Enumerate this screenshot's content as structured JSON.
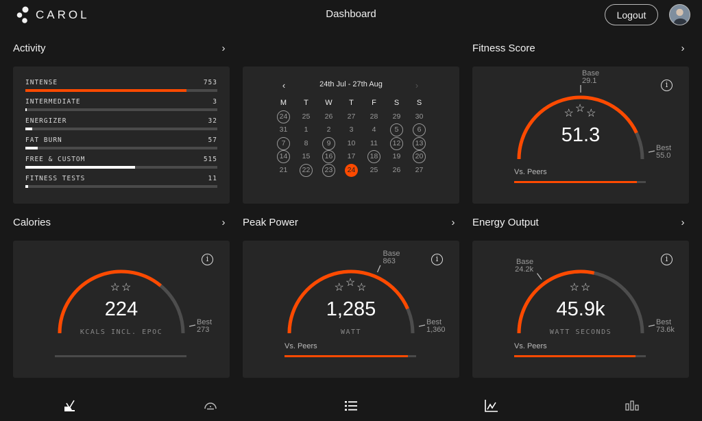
{
  "app": {
    "brand": "CAROL",
    "title": "Dashboard",
    "logout_label": "Logout",
    "accent_color": "#ff4a00"
  },
  "sections": {
    "activity": {
      "title": "Activity"
    },
    "fitness": {
      "title": "Fitness Score"
    },
    "calories": {
      "title": "Calories"
    },
    "peak": {
      "title": "Peak Power"
    },
    "energy": {
      "title": "Energy Output"
    }
  },
  "activity": {
    "items": [
      {
        "label": "INTENSE",
        "value": "753",
        "fraction": 0.84,
        "accent": true
      },
      {
        "label": "INTERMEDIATE",
        "value": "3",
        "fraction": 0.004,
        "accent": false
      },
      {
        "label": "ENERGIZER",
        "value": "32",
        "fraction": 0.036,
        "accent": false
      },
      {
        "label": "FAT BURN",
        "value": "57",
        "fraction": 0.065,
        "accent": false
      },
      {
        "label": "FREE & CUSTOM",
        "value": "515",
        "fraction": 0.571,
        "accent": false
      },
      {
        "label": "FITNESS TESTS",
        "value": "11",
        "fraction": 0.013,
        "accent": false
      }
    ]
  },
  "calendar": {
    "range": "24th Jul - 27th Aug",
    "prev_icon": "chevron-left-icon",
    "next_icon": "chevron-right-icon",
    "weekdays": [
      "M",
      "T",
      "W",
      "T",
      "F",
      "S",
      "S"
    ],
    "days": [
      {
        "d": "24",
        "ring": true
      },
      {
        "d": "25"
      },
      {
        "d": "26"
      },
      {
        "d": "27"
      },
      {
        "d": "28"
      },
      {
        "d": "29"
      },
      {
        "d": "30"
      },
      {
        "d": "31"
      },
      {
        "d": "1"
      },
      {
        "d": "2"
      },
      {
        "d": "3"
      },
      {
        "d": "4"
      },
      {
        "d": "5",
        "ring": true
      },
      {
        "d": "6",
        "ring": true
      },
      {
        "d": "7",
        "ring": true
      },
      {
        "d": "8"
      },
      {
        "d": "9",
        "ring": true
      },
      {
        "d": "10"
      },
      {
        "d": "11"
      },
      {
        "d": "12",
        "ring": true
      },
      {
        "d": "13",
        "ring": true
      },
      {
        "d": "14",
        "ring": true
      },
      {
        "d": "15"
      },
      {
        "d": "16",
        "ring": true
      },
      {
        "d": "17"
      },
      {
        "d": "18",
        "ring": true
      },
      {
        "d": "19"
      },
      {
        "d": "20",
        "ring": true
      },
      {
        "d": "21"
      },
      {
        "d": "22",
        "ring": true
      },
      {
        "d": "23",
        "ring": true
      },
      {
        "d": "24",
        "today": true
      },
      {
        "d": "25"
      },
      {
        "d": "26"
      },
      {
        "d": "27"
      }
    ]
  },
  "gauges": {
    "fitness": {
      "value": "51.3",
      "unit": "",
      "stars": 3,
      "fill_fraction": 0.86,
      "base": {
        "label": "Base",
        "value": "29.1",
        "fraction": 0.5
      },
      "best": {
        "label": "Best",
        "value": "55.0"
      },
      "peers": {
        "label": "Vs. Peers",
        "fraction": 0.93
      }
    },
    "calories": {
      "value": "224",
      "unit": "KCALS INCL. EPOC",
      "stars": 2,
      "fill_fraction": 0.72,
      "best": {
        "label": "Best",
        "value": "273"
      },
      "peers": {
        "label": "",
        "fraction": 0
      }
    },
    "peak": {
      "value": "1,285",
      "unit": "WATT",
      "stars": 3,
      "fill_fraction": 0.87,
      "base": {
        "label": "Base",
        "value": "863",
        "fraction": 0.63
      },
      "best": {
        "label": "Best",
        "value": "1,360"
      },
      "peers": {
        "label": "Vs. Peers",
        "fraction": 0.94
      }
    },
    "energy": {
      "value": "45.9k",
      "unit": "WATT SECONDS",
      "stars": 2,
      "fill_fraction": 0.57,
      "base": {
        "label": "Base",
        "value": "24.2k",
        "fraction": 0.3
      },
      "best": {
        "label": "Best",
        "value": "73.6k"
      },
      "peers": {
        "label": "Vs. Peers",
        "fraction": 0.92
      }
    }
  },
  "info_glyph": "i",
  "bottom_nav": [
    {
      "name": "workout",
      "icon": "bike-icon"
    },
    {
      "name": "gauge",
      "icon": "gauge-icon"
    },
    {
      "name": "list",
      "icon": "list-icon"
    },
    {
      "name": "trend",
      "icon": "line-chart-icon"
    },
    {
      "name": "stats",
      "icon": "bar-chart-icon"
    }
  ]
}
